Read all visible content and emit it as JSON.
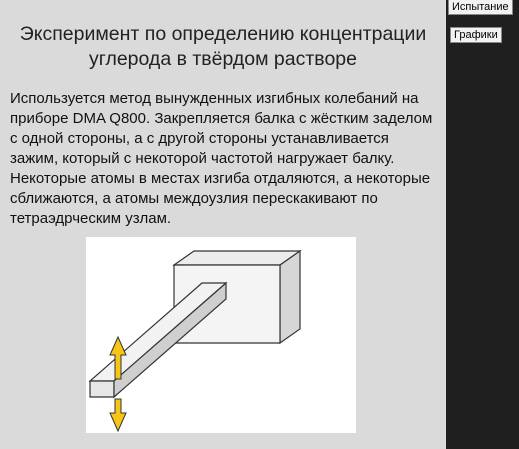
{
  "main": {
    "title": "Эксперимент по определению концентрации углерода в твёрдом растворе",
    "description": "Используется метод вынужденных изгибных колебаний на приборе DMA Q800. Закрепляется балка с жёстким заделом с одной стороны, а с другой стороны устанавливается зажим, который с некоторой частотой нагружает балку. Некоторые атомы в местах изгиба отдаляются, а некоторые сближаются, а атомы междоузлия перескакивают по тетраэдрческим узлам."
  },
  "sidebar": {
    "buttons": [
      {
        "label": "Испытание"
      },
      {
        "label": "Графики"
      }
    ]
  },
  "figure": {
    "arrow_color": "#f5c518"
  }
}
